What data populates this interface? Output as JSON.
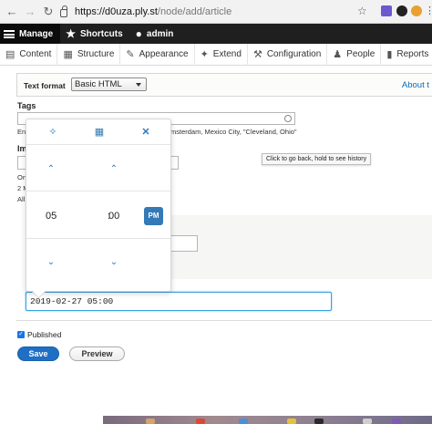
{
  "browser": {
    "url_host": "https://d0uza.ply.st",
    "url_path": "/node/add/article"
  },
  "toolbar": {
    "manage": "Manage",
    "shortcuts": "Shortcuts",
    "user": "admin"
  },
  "admin_menu": {
    "items": [
      {
        "label": "Content",
        "icon": "content-icon"
      },
      {
        "label": "Structure",
        "icon": "structure-icon"
      },
      {
        "label": "Appearance",
        "icon": "appearance-icon"
      },
      {
        "label": "Extend",
        "icon": "extend-icon"
      },
      {
        "label": "Configuration",
        "icon": "configuration-icon"
      },
      {
        "label": "People",
        "icon": "people-icon"
      },
      {
        "label": "Reports",
        "icon": "reports-icon"
      }
    ]
  },
  "form": {
    "text_format_label": "Text format",
    "text_format_value": "Basic HTML",
    "about_link": "About t",
    "tags_label": "Tags",
    "tags_value": "",
    "tags_desc_prefix": "Ent",
    "tags_desc_suffix": "msterdam, Mexico City, \"Cleveland, Ohio\"",
    "image_label": "Im",
    "image_line1": "On",
    "image_line2": "2 M",
    "image_line3": "All",
    "date_value": "2019-02-27 05:00",
    "published_label": "Published",
    "save_label": "Save",
    "preview_label": "Preview"
  },
  "tooltip": "Click to go back, hold to see history",
  "time_picker": {
    "hours": "05",
    "minutes": "00",
    "colon": ":",
    "period": "PM"
  }
}
